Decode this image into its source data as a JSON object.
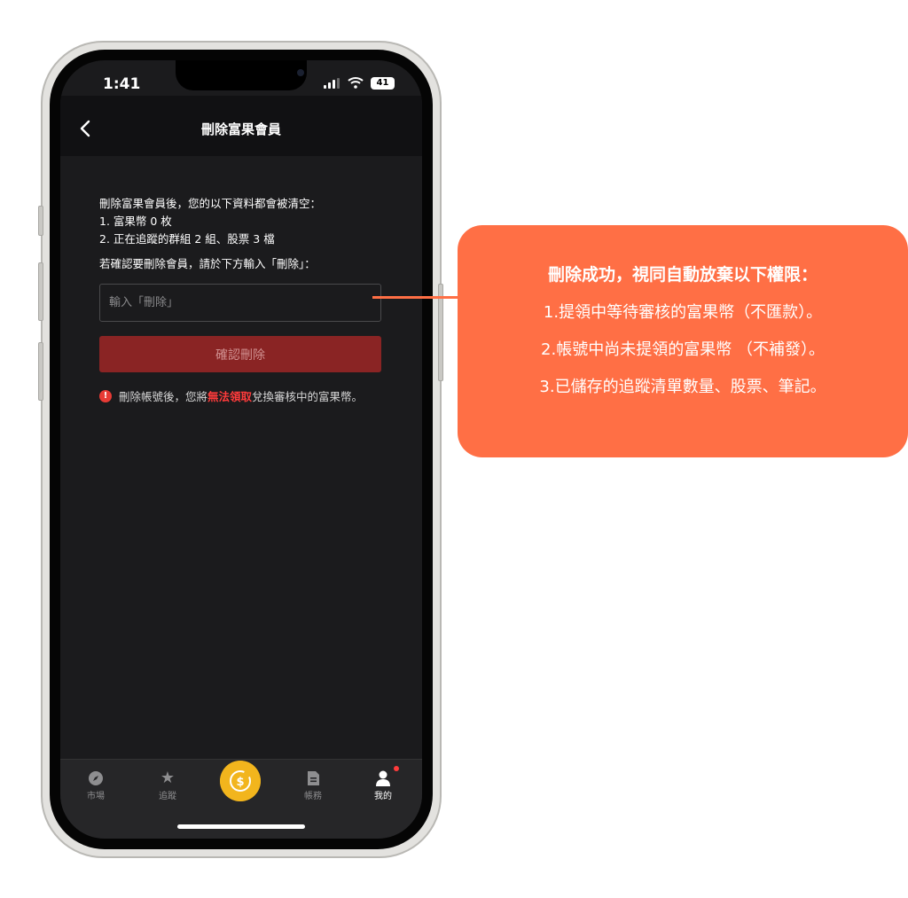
{
  "status_bar": {
    "time": "1:41",
    "battery": "41"
  },
  "header": {
    "title": "刪除富果會員"
  },
  "content": {
    "line1": "刪除富果會員後，您的以下資料都會被清空：",
    "line2": "1. 富果幣 0 枚",
    "line3": "2. 正在追蹤的群組 2 組、股票 3 檔",
    "line4": "若確認要刪除會員，請於下方輸入「刪除」：",
    "input_placeholder": "輸入「刪除」",
    "confirm_label": "確認刪除",
    "warning_prefix": "刪除帳號後，您將",
    "warning_highlight": "無法領取",
    "warning_suffix": "兌換審核中的富果幣。"
  },
  "tabbar": {
    "items": [
      {
        "label": "市場",
        "icon": "compass-icon"
      },
      {
        "label": "追蹤",
        "icon": "star-icon"
      },
      {
        "label": "帳務",
        "icon": "document-icon"
      },
      {
        "label": "我的",
        "icon": "person-icon"
      }
    ],
    "center_icon": "coin-dollar-icon"
  },
  "callout": {
    "title": "刪除成功，視同自動放棄以下權限：",
    "line1": "1.提領中等待審核的富果幣（不匯款）。",
    "line2": "2.帳號中尚未提領的富果幣 （不補發）。",
    "line3": "3.已儲存的追蹤清單數量、股票、筆記。"
  },
  "colors": {
    "accent": "#ff6f45",
    "danger": "#ff3b3b",
    "coin": "#f2b51d",
    "button": "#8a2424"
  }
}
